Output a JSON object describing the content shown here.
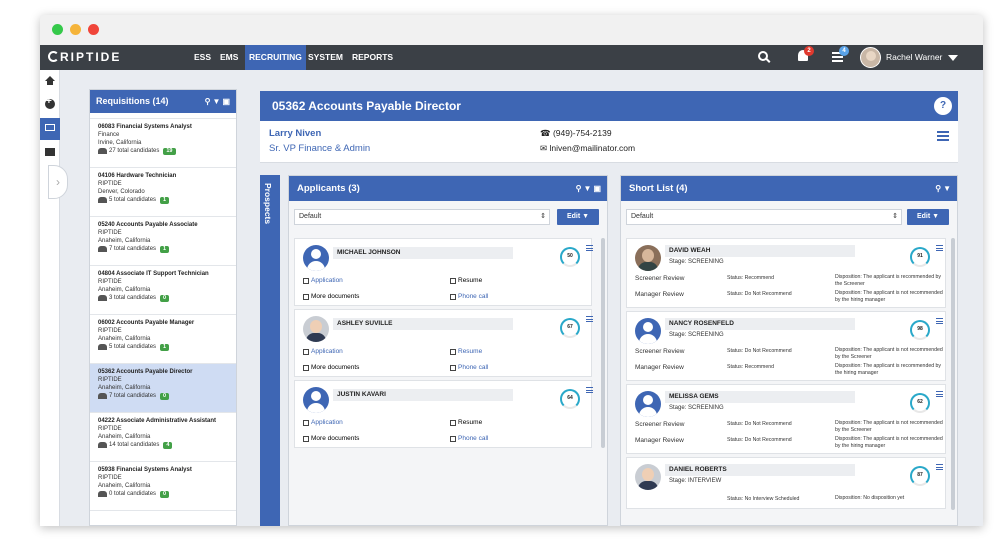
{
  "nav": {
    "logo": "RIPTIDE",
    "items": [
      {
        "label": "ESS"
      },
      {
        "label": "EMS"
      },
      {
        "label": "RECRUITING"
      },
      {
        "label": "SYSTEM"
      },
      {
        "label": "REPORTS"
      }
    ],
    "active": "RECRUITING",
    "notifications_count": "2",
    "tasks_count": "4",
    "user_name": "Rachel Warner"
  },
  "requisitions": {
    "title": "Requisitions (14)",
    "items": [
      {
        "title": "06083 Financial Systems Analyst",
        "org": "Finance",
        "location": "Irvine, California",
        "candidates": "27 total candidates",
        "badge": "19"
      },
      {
        "title": "04106 Hardware Technician",
        "org": "RIPTIDE",
        "location": "Denver, Colorado",
        "candidates": "5 total candidates",
        "badge": "1"
      },
      {
        "title": "05240 Accounts Payable Associate",
        "org": "RIPTIDE",
        "location": "Anaheim, California",
        "candidates": "7 total candidates",
        "badge": "1"
      },
      {
        "title": "04804 Associate IT Support Technician",
        "org": "RIPTIDE",
        "location": "Anaheim, California",
        "candidates": "3 total candidates",
        "badge": "0"
      },
      {
        "title": "06002 Accounts Payable Manager",
        "org": "RIPTIDE",
        "location": "Anaheim, California",
        "candidates": "5 total candidates",
        "badge": "1"
      },
      {
        "title": "05362 Accounts Payable Director",
        "org": "RIPTIDE",
        "location": "Anaheim, California",
        "candidates": "7 total candidates",
        "badge": "0"
      },
      {
        "title": "04222 Associate Administrative Assistant",
        "org": "RIPTIDE",
        "location": "Anaheim, California",
        "candidates": "14 total candidates",
        "badge": "4"
      },
      {
        "title": "05938 Financial Systems Analyst",
        "org": "RIPTIDE",
        "location": "Anaheim, California",
        "candidates": "0 total candidates",
        "badge": "0"
      }
    ]
  },
  "header": {
    "title": "05362 Accounts Payable Director",
    "help": "?"
  },
  "contact": {
    "name": "Larry Niven",
    "title": "Sr. VP Finance & Admin",
    "phone": "(949)-754-2139",
    "email": "lniven@mailinator.com"
  },
  "prospects_label": "Prospects",
  "applicants": {
    "title": "Applicants (3)",
    "filter": "Default",
    "edit_label": "Edit",
    "cards": [
      {
        "name": "MICHAEL JOHNSON",
        "score": "50",
        "application": "Application",
        "resume": "Resume",
        "more": "More documents",
        "phone": "Phone call"
      },
      {
        "name": "ASHLEY SUVILLE",
        "score": "67",
        "application": "Application",
        "resume": "Resume",
        "more": "More documents",
        "phone": "Phone call"
      },
      {
        "name": "JUSTIN KAVARI",
        "score": "64",
        "application": "Application",
        "resume": "Resume",
        "more": "More documents",
        "phone": "Phone call"
      }
    ]
  },
  "shortlist": {
    "title": "Short List (4)",
    "filter": "Default",
    "edit_label": "Edit",
    "cards": [
      {
        "name": "DAVID WEAH",
        "stage": "Stage: SCREENING",
        "score": "91",
        "rows": [
          {
            "label": "Screener Review",
            "status": "Status: Recommend",
            "disposition": "Disposition: The applicant is recommended by the Screener"
          },
          {
            "label": "Manager Review",
            "status": "Status: Do Not Recommend",
            "disposition": "Disposition: The applicant is not recommended by the hiring manager"
          }
        ]
      },
      {
        "name": "NANCY ROSENFELD",
        "stage": "Stage: SCREENING",
        "score": "98",
        "rows": [
          {
            "label": "Screener Review",
            "status": "Status: Do Not Recommend",
            "disposition": "Disposition: The applicant is not recommended by the Screener"
          },
          {
            "label": "Manager Review",
            "status": "Status: Recommend",
            "disposition": "Disposition: The applicant is recommended by the hiring manager"
          }
        ]
      },
      {
        "name": "MELISSA GEMS",
        "stage": "Stage: SCREENING",
        "score": "62",
        "rows": [
          {
            "label": "Screener Review",
            "status": "Status: Do Not Recommend",
            "disposition": "Disposition: The applicant is not recommended by the Screener"
          },
          {
            "label": "Manager Review",
            "status": "Status: Do Not Recommend",
            "disposition": "Disposition: The applicant is not recommended by the hiring manager"
          }
        ]
      },
      {
        "name": "DANIEL ROBERTS",
        "stage": "Stage: INTERVIEW",
        "score": "87",
        "rows": [
          {
            "label": "",
            "status": "Status: No Interview Scheduled",
            "disposition": "Disposition: No disposition yet"
          }
        ]
      }
    ]
  },
  "colors": {
    "accent": "#3e66b4",
    "nav_bg": "#3b4046",
    "badge_green": "#43a047"
  }
}
